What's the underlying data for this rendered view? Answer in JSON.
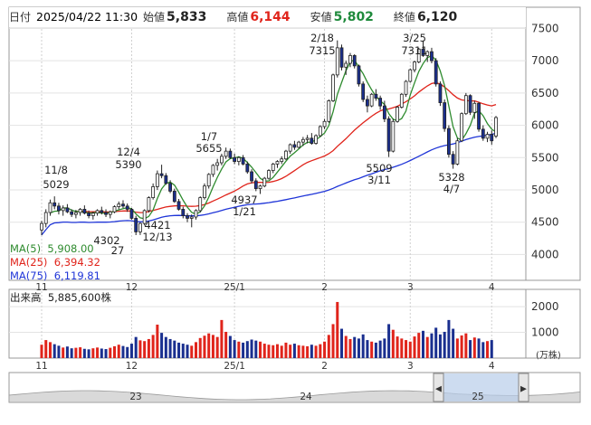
{
  "header": {
    "date_label": "日付",
    "date_value": "2025/04/22 11:30",
    "open_label": "始値",
    "open_value": "5,833",
    "high_label": "高値",
    "high_value": "6,144",
    "low_label": "安値",
    "low_value": "5,802",
    "close_label": "終値",
    "close_value": "6,120"
  },
  "legend": {
    "ma5_label": "MA(5)",
    "ma5_value": "5,908.00",
    "ma25_label": "MA(25)",
    "ma25_value": "6,394.32",
    "ma75_label": "MA(75)",
    "ma75_value": "6,119.81"
  },
  "volume_panel": {
    "label": "出来高",
    "value": "5,885,600株",
    "unit": "(万株)"
  },
  "colors": {
    "up_candle": "#ffffff",
    "down_candle": "#1a2f8f",
    "ma5": "#2e8b2e",
    "ma25": "#e0241b",
    "ma75": "#1f35d8",
    "volume_up": "#e0241b",
    "volume_down": "#1a2f8f"
  },
  "chart_data": {
    "type": "candlestick",
    "price_axis": {
      "ticks": [
        4000,
        4500,
        5000,
        5500,
        6000,
        6500,
        7000,
        7500
      ],
      "range": [
        3600,
        7800
      ]
    },
    "volume_axis": {
      "ticks": [
        1000,
        2000
      ],
      "range": [
        0,
        2600
      ]
    },
    "month_labels": [
      "11",
      "12",
      "25/1",
      "2",
      "3",
      "4"
    ],
    "annotations": [
      {
        "date": "11/8",
        "value": "5029"
      },
      {
        "date": "12/4",
        "value": "5390"
      },
      {
        "date": "1/7",
        "value": "5655"
      },
      {
        "date": "2/18",
        "value": "7315"
      },
      {
        "date": "3/25",
        "value": "7311"
      },
      {
        "date": "",
        "value": "4302"
      },
      {
        "date": "27",
        "value": ""
      },
      {
        "date": "12/13",
        "value": "4421"
      },
      {
        "date": "1/21",
        "value": "4937"
      },
      {
        "date": "3/11",
        "value": "5509"
      },
      {
        "date": "4/7",
        "value": "5328"
      }
    ],
    "candles": [
      [
        4380,
        4520,
        4300,
        4480
      ],
      [
        4480,
        4700,
        4420,
        4650
      ],
      [
        4650,
        4850,
        4600,
        4800
      ],
      [
        4800,
        4900,
        4700,
        4750
      ],
      [
        4750,
        4800,
        4620,
        4680
      ],
      [
        4680,
        4760,
        4600,
        4720
      ],
      [
        4720,
        4780,
        4640,
        4660
      ],
      [
        4660,
        4700,
        4580,
        4620
      ],
      [
        4620,
        4690,
        4560,
        4650
      ],
      [
        4650,
        4720,
        4600,
        4700
      ],
      [
        4700,
        4760,
        4620,
        4640
      ],
      [
        4640,
        4680,
        4560,
        4600
      ],
      [
        4600,
        4660,
        4540,
        4640
      ],
      [
        4640,
        4700,
        4600,
        4680
      ],
      [
        4680,
        4740,
        4620,
        4650
      ],
      [
        4650,
        4700,
        4580,
        4620
      ],
      [
        4620,
        4680,
        4560,
        4660
      ],
      [
        4660,
        4760,
        4640,
        4740
      ],
      [
        4740,
        4820,
        4700,
        4780
      ],
      [
        4780,
        4840,
        4720,
        4750
      ],
      [
        4750,
        4790,
        4660,
        4700
      ],
      [
        4700,
        4720,
        4540,
        4560
      ],
      [
        4560,
        4600,
        4300,
        4350
      ],
      [
        4350,
        4500,
        4302,
        4480
      ],
      [
        4480,
        4700,
        4450,
        4680
      ],
      [
        4680,
        4900,
        4650,
        4880
      ],
      [
        4880,
        5100,
        4850,
        5050
      ],
      [
        5050,
        5300,
        5000,
        5250
      ],
      [
        5250,
        5390,
        5180,
        5220
      ],
      [
        5220,
        5260,
        5080,
        5100
      ],
      [
        5100,
        5150,
        4950,
        4980
      ],
      [
        4980,
        5020,
        4800,
        4820
      ],
      [
        4820,
        4860,
        4680,
        4700
      ],
      [
        4700,
        4740,
        4560,
        4600
      ],
      [
        4600,
        4640,
        4500,
        4560
      ],
      [
        4560,
        4620,
        4421,
        4580
      ],
      [
        4580,
        4700,
        4540,
        4680
      ],
      [
        4680,
        4900,
        4650,
        4880
      ],
      [
        4880,
        5100,
        4850,
        5060
      ],
      [
        5060,
        5260,
        5020,
        5240
      ],
      [
        5240,
        5400,
        5200,
        5380
      ],
      [
        5380,
        5480,
        5300,
        5420
      ],
      [
        5420,
        5560,
        5380,
        5520
      ],
      [
        5520,
        5655,
        5480,
        5600
      ],
      [
        5600,
        5640,
        5480,
        5500
      ],
      [
        5500,
        5560,
        5400,
        5440
      ],
      [
        5440,
        5520,
        5380,
        5500
      ],
      [
        5500,
        5540,
        5380,
        5400
      ],
      [
        5400,
        5440,
        5250,
        5280
      ],
      [
        5280,
        5320,
        5100,
        5140
      ],
      [
        5140,
        5180,
        4980,
        5020
      ],
      [
        5020,
        5080,
        4937,
        5060
      ],
      [
        5060,
        5200,
        5040,
        5180
      ],
      [
        5180,
        5320,
        5160,
        5300
      ],
      [
        5300,
        5420,
        5260,
        5400
      ],
      [
        5400,
        5460,
        5340,
        5440
      ],
      [
        5440,
        5520,
        5400,
        5480
      ],
      [
        5480,
        5620,
        5460,
        5600
      ],
      [
        5600,
        5720,
        5560,
        5700
      ],
      [
        5700,
        5760,
        5620,
        5660
      ],
      [
        5660,
        5760,
        5640,
        5740
      ],
      [
        5740,
        5820,
        5680,
        5780
      ],
      [
        5780,
        5850,
        5720,
        5800
      ],
      [
        5800,
        5880,
        5700,
        5720
      ],
      [
        5720,
        5860,
        5700,
        5840
      ],
      [
        5840,
        6000,
        5820,
        5980
      ],
      [
        5980,
        6100,
        5940,
        6060
      ],
      [
        6060,
        6400,
        6040,
        6380
      ],
      [
        6380,
        6800,
        6360,
        6780
      ],
      [
        6780,
        7315,
        6740,
        7200
      ],
      [
        7200,
        7250,
        6850,
        6900
      ],
      [
        6900,
        7000,
        6780,
        6960
      ],
      [
        6960,
        7120,
        6900,
        7080
      ],
      [
        7080,
        7100,
        6880,
        6920
      ],
      [
        6920,
        6940,
        6600,
        6640
      ],
      [
        6640,
        6680,
        6360,
        6400
      ],
      [
        6400,
        6460,
        6200,
        6300
      ],
      [
        6300,
        6500,
        6280,
        6480
      ],
      [
        6480,
        6560,
        6380,
        6420
      ],
      [
        6420,
        6460,
        6240,
        6300
      ],
      [
        6300,
        6380,
        6050,
        6100
      ],
      [
        6100,
        6140,
        5509,
        5600
      ],
      [
        5600,
        6100,
        5580,
        6060
      ],
      [
        6060,
        6300,
        6040,
        6280
      ],
      [
        6280,
        6500,
        6260,
        6480
      ],
      [
        6480,
        6700,
        6440,
        6680
      ],
      [
        6680,
        6880,
        6660,
        6860
      ],
      [
        6860,
        7000,
        6820,
        6980
      ],
      [
        6980,
        7200,
        6960,
        7180
      ],
      [
        7180,
        7311,
        7060,
        7080
      ],
      [
        7080,
        7160,
        6980,
        7140
      ],
      [
        7140,
        7200,
        6960,
        7000
      ],
      [
        7000,
        7040,
        6600,
        6640
      ],
      [
        6640,
        6680,
        6300,
        6350
      ],
      [
        6350,
        6400,
        5900,
        5950
      ],
      [
        5950,
        6000,
        5500,
        5550
      ],
      [
        5550,
        5600,
        5328,
        5400
      ],
      [
        5400,
        5800,
        5380,
        5760
      ],
      [
        5760,
        6200,
        5740,
        6180
      ],
      [
        6180,
        6500,
        6160,
        6460
      ],
      [
        6460,
        6480,
        6160,
        6200
      ],
      [
        6200,
        6380,
        6100,
        6340
      ],
      [
        6340,
        6360,
        5900,
        5940
      ],
      [
        5940,
        6000,
        5760,
        5800
      ],
      [
        5800,
        5900,
        5740,
        5860
      ],
      [
        5860,
        5920,
        5700,
        5760
      ],
      [
        5833,
        6144,
        5802,
        6120
      ]
    ],
    "volumes": [
      520,
      700,
      620,
      540,
      480,
      410,
      450,
      380,
      400,
      420,
      360,
      340,
      380,
      410,
      370,
      350,
      400,
      460,
      520,
      470,
      430,
      560,
      820,
      690,
      660,
      740,
      900,
      1300,
      980,
      820,
      740,
      680,
      600,
      560,
      520,
      480,
      620,
      780,
      870,
      960,
      900,
      820,
      1480,
      1020,
      860,
      700,
      640,
      600,
      660,
      720,
      680,
      640,
      560,
      520,
      500,
      540,
      480,
      600,
      520,
      560,
      500,
      480,
      460,
      520,
      480,
      540,
      640,
      900,
      1320,
      2180,
      1140,
      860,
      740,
      820,
      760,
      920,
      700,
      640,
      600,
      680,
      760,
      1320,
      1100,
      840,
      760,
      700,
      640,
      840,
      980,
      1060,
      820,
      960,
      1180,
      920,
      1020,
      1480,
      1140,
      760,
      880,
      960,
      700,
      800,
      760,
      620,
      660,
      700
    ]
  }
}
